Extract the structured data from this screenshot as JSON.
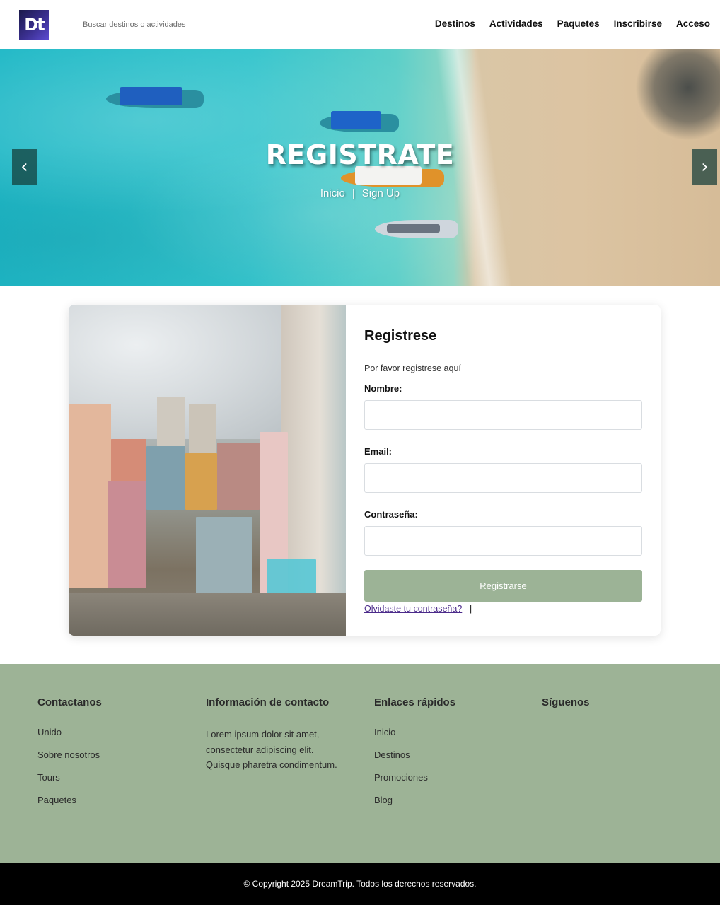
{
  "header": {
    "logo_text": "Dt",
    "search_placeholder": "Buscar destinos o actividades",
    "nav": [
      {
        "label": "Destinos"
      },
      {
        "label": "Actividades"
      },
      {
        "label": "Paquetes"
      },
      {
        "label": "Inscribirse"
      },
      {
        "label": "Acceso"
      }
    ]
  },
  "hero": {
    "title": "REGISTRATE",
    "breadcrumb_home": "Inicio",
    "breadcrumb_sep": "|",
    "breadcrumb_current": "Sign Up",
    "prev_arrow": "‹",
    "next_arrow": "›"
  },
  "form": {
    "title": "Registrese",
    "subtitle": "Por favor registrese aquí",
    "name_label": "Nombre:",
    "email_label": "Email:",
    "password_label": "Contraseña:",
    "name_value": "",
    "email_value": "",
    "password_value": "",
    "submit_label": "Registrarse",
    "forgot_label": "Olvidaste tu contraseña?",
    "forgot_suffix": "|"
  },
  "footer": {
    "col1": {
      "title": "Contactanos",
      "links": [
        "Unido",
        "Sobre nosotros",
        "Tours",
        "Paquetes"
      ]
    },
    "col2": {
      "title": "Información de contacto",
      "text": "Lorem ipsum dolor sit amet, consectetur adipiscing elit. Quisque pharetra condimentum."
    },
    "col3": {
      "title": "Enlaces rápidos",
      "links": [
        "Inicio",
        "Destinos",
        "Promociones",
        "Blog"
      ]
    },
    "col4": {
      "title": "Síguenos"
    },
    "copyright": "© Copyright 2025 DreamTrip. Todos los derechos reservados."
  },
  "colors": {
    "accent_green": "#9cb396",
    "footer_green": "#9db396",
    "link_purple": "#4b2a8a"
  },
  "icons": [
    "chevron-left-icon",
    "chevron-right-icon"
  ]
}
